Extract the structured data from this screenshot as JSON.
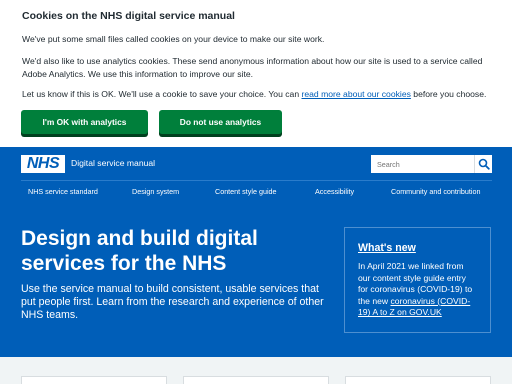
{
  "cookie_banner": {
    "title": "Cookies on the NHS digital service manual",
    "p1": "We've put some small files called cookies on your device to make our site work.",
    "p2": "We'd also like to use analytics cookies. These send anonymous information about how our site is used to a service called Adobe Analytics. We use this information to improve our site.",
    "p3_before": "Let us know if this is OK. We'll use a cookie to save your choice. You can ",
    "p3_link": "read more about our cookies",
    "p3_after": " before you choose.",
    "accept_label": "I'm OK with analytics cookies",
    "reject_label": "Do not use analytics cookies"
  },
  "header": {
    "logo_text": "NHS",
    "service_name": "Digital service manual",
    "search_placeholder": "Search",
    "icons": {
      "search": "search-icon"
    }
  },
  "nav": {
    "items": [
      "NHS service standard",
      "Design system",
      "Content style guide",
      "Accessibility",
      "Community and contribution"
    ]
  },
  "hero": {
    "title": "Design and build digital services for the NHS",
    "text": "Use the service manual to build consistent, usable services that put people first. Learn from the research and experience of other NHS teams."
  },
  "whats_new": {
    "title": "What's new",
    "text_before": "In April 2021 we linked from our content style guide entry for coronavirus (COVID-19) to the new ",
    "link": "coronavirus (COVID-19) A to Z on GOV.UK"
  },
  "colors": {
    "nhs_blue": "#005eb8",
    "button_green": "#007f3b",
    "pale_grey": "#f0f4f5",
    "text": "#212b32"
  }
}
